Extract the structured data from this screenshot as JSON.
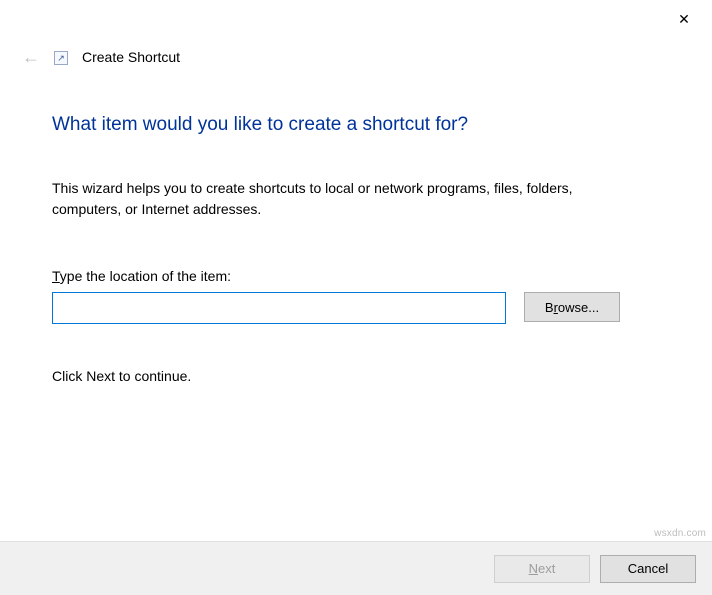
{
  "titlebar": {
    "close_glyph": "✕"
  },
  "header": {
    "back_glyph": "←",
    "shortcut_glyph": "↗",
    "title": "Create Shortcut"
  },
  "main": {
    "heading": "What item would you like to create a shortcut for?",
    "description": "This wizard helps you to create shortcuts to local or network programs, files, folders, computers, or Internet addresses.",
    "field_label_pre": "T",
    "field_label_rest": "ype the location of the item:",
    "location_value": "",
    "browse_pre": "B",
    "browse_u": "r",
    "browse_post": "owse...",
    "hint": "Click Next to continue."
  },
  "footer": {
    "next_u": "N",
    "next_post": "ext",
    "cancel": "Cancel"
  },
  "watermark": "wsxdn.com"
}
